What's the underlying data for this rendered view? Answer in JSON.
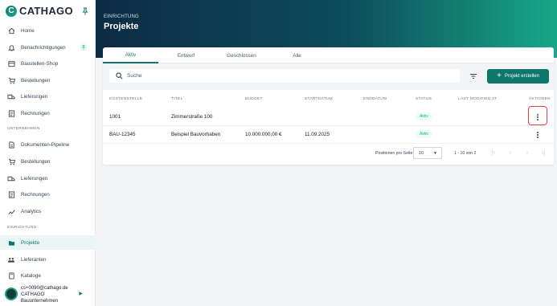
{
  "brand": {
    "name": "CATHAGO"
  },
  "sidebar": {
    "items": [
      {
        "label": "Home",
        "icon": "home-icon"
      },
      {
        "label": "Benachrichtigungen",
        "icon": "bell-icon",
        "badge": "0"
      },
      {
        "label": "Baustellen-Shop",
        "icon": "shop-icon"
      },
      {
        "label": "Bestellungen",
        "icon": "cart-icon"
      },
      {
        "label": "Lieferungen",
        "icon": "truck-icon"
      },
      {
        "label": "Rechnungen",
        "icon": "invoice-icon"
      }
    ],
    "sections": [
      {
        "label": "UNTERNEHMEN",
        "items": [
          {
            "label": "Dokumenten-Pipeline",
            "icon": "document-icon"
          },
          {
            "label": "Bestellungen",
            "icon": "cart-icon"
          },
          {
            "label": "Lieferungen",
            "icon": "truck-icon"
          },
          {
            "label": "Rechnungen",
            "icon": "invoice-icon"
          },
          {
            "label": "Analytics",
            "icon": "chart-icon"
          }
        ]
      },
      {
        "label": "EINRICHTUNG",
        "items": [
          {
            "label": "Projekte",
            "icon": "folder-icon",
            "active": true
          },
          {
            "label": "Lieferanten",
            "icon": "people-icon"
          },
          {
            "label": "Kataloge",
            "icon": "book-icon"
          }
        ]
      }
    ],
    "user": {
      "email": "cs+0090@cathago.de",
      "company_line1": "CATHAGO",
      "company_line2": "Bauunternehmen"
    }
  },
  "header": {
    "supertitle": "EINRICHTUNG",
    "title": "Projekte"
  },
  "tabs": [
    {
      "label": "Aktiv",
      "active": true
    },
    {
      "label": "Entwurf"
    },
    {
      "label": "Geschlossen"
    },
    {
      "label": "Alle"
    }
  ],
  "toolbar": {
    "search_placeholder": "Suche",
    "create_label": "Projekt erstellen"
  },
  "table": {
    "columns": [
      "KOSTENSTELLE",
      "TITEL",
      "BUDGET",
      "STARTDATUM",
      "ENDDATUM",
      "STATUS",
      "LAST MODIFIED AT",
      "AKTIONEN"
    ],
    "rows": [
      {
        "kostenstelle": "1001",
        "titel": "Zimmerstraße 100",
        "budget": "",
        "startdatum": "",
        "enddatum": "",
        "status": "Aktiv",
        "last_modified": ""
      },
      {
        "kostenstelle": "BAU-12345",
        "titel": "Beispiel Bauvorhaben",
        "budget": "10.000.000,00 €",
        "startdatum": "11.09.2025",
        "enddatum": "",
        "status": "Aktiv",
        "last_modified": ""
      }
    ]
  },
  "pagination": {
    "rows_per_page_label": "Positionen pro Seite",
    "rows_per_page": "10",
    "range": "1 - 10 von 2"
  },
  "colors": {
    "accent": "#0f766e",
    "status_green": "#10b981",
    "highlight": "#e0443a"
  }
}
